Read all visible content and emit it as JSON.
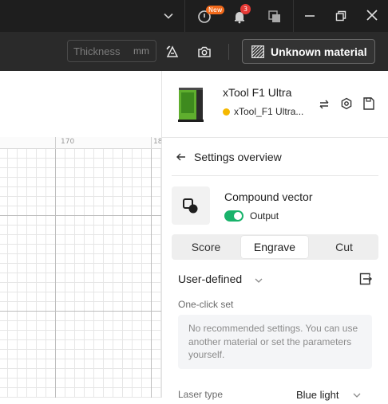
{
  "titlebar": {
    "badge_new": "New",
    "notification_count": "3",
    "icons": [
      "chevron-down-icon",
      "power-icon",
      "bell-icon",
      "layers-icon",
      "minimize-icon",
      "restore-icon",
      "close-icon"
    ]
  },
  "toolbar": {
    "thickness_placeholder": "Thickness",
    "thickness_unit": "mm",
    "material_label": "Unknown material"
  },
  "ruler": {
    "labels": [
      "170",
      "18"
    ]
  },
  "device": {
    "name": "xTool F1 Ultra",
    "connection": "xTool_F1 Ultra...",
    "status_color": "#f5b800"
  },
  "settings": {
    "back_label": "Settings overview",
    "object_name": "Compound vector",
    "output_label": "Output",
    "output_enabled": true,
    "tabs": [
      {
        "label": "Score"
      },
      {
        "label": "Engrave"
      },
      {
        "label": "Cut"
      }
    ],
    "active_tab": "Engrave",
    "preset_label": "User-defined",
    "one_click_label": "One-click set",
    "info_text": "No recommended settings. You can use another material or set the parameters yourself.",
    "laser_type_label": "Laser type",
    "laser_type_value": "Blue light"
  },
  "colors": {
    "titlebar_bg": "#1e1e1e",
    "toolbar_bg": "#2a2a2a",
    "accent_green": "#19b36b",
    "badge_orange": "#f26a1b",
    "badge_red": "#e53935"
  }
}
